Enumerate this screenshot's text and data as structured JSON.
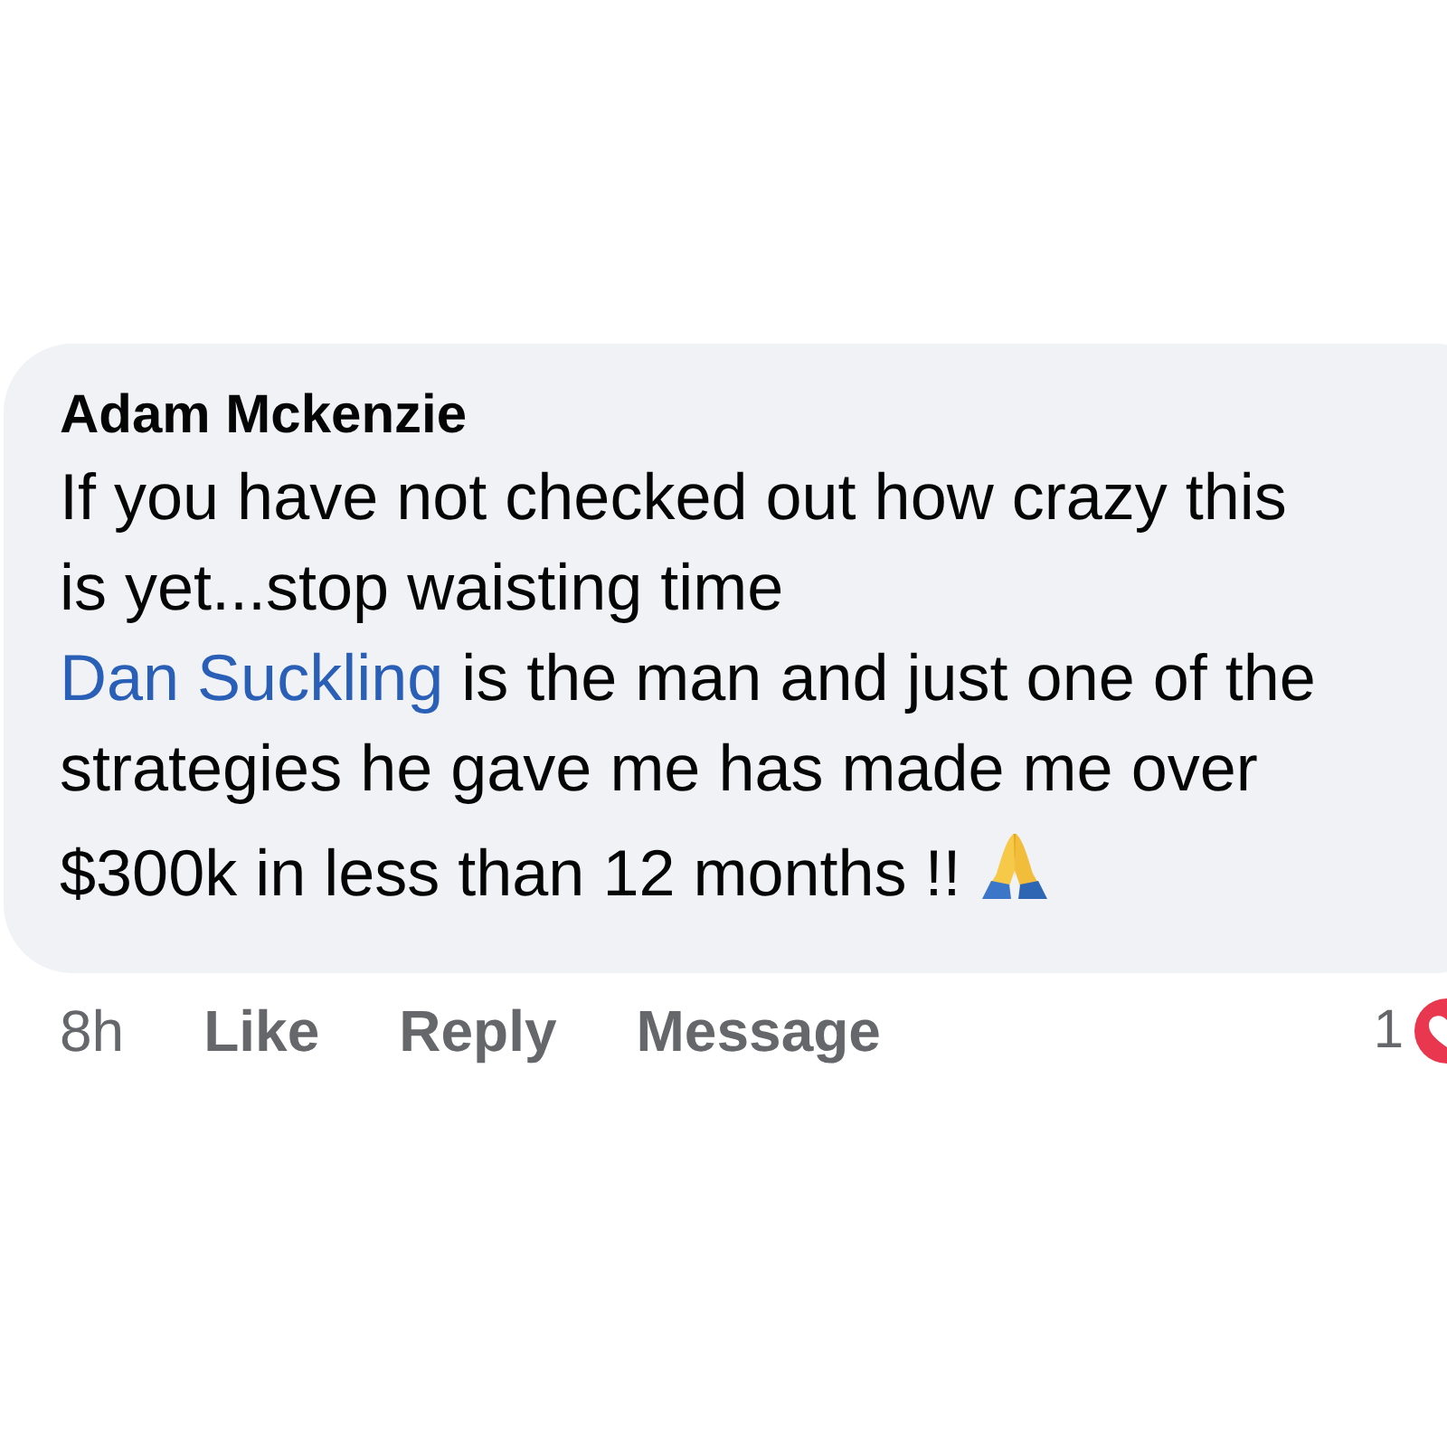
{
  "comment": {
    "author": "Adam Mckenzie",
    "lines": [
      {
        "text": "If you have not checked out how crazy this"
      },
      {
        "text": "is yet...stop waisting time"
      },
      {
        "mention": "Dan Suckling",
        "text": " is the man and just one of the"
      },
      {
        "text": "strategies he gave me has made me over"
      },
      {
        "text": "$300k in less than 12 months !!",
        "trailing_icon": true
      }
    ],
    "time": "8h",
    "actions": [
      "Like",
      "Reply",
      "Message"
    ],
    "reaction_count": "1"
  }
}
